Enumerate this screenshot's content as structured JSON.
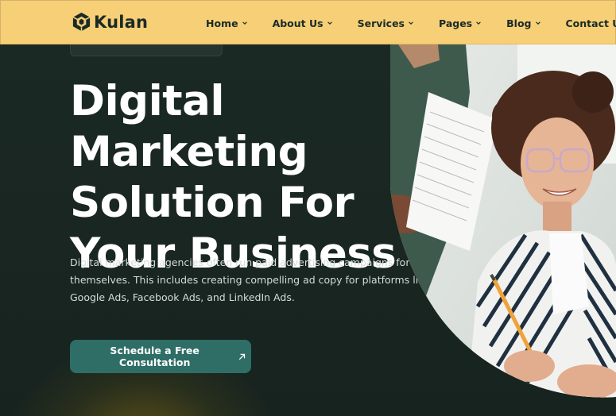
{
  "brand": {
    "name": "Kulan",
    "logo_icon": "cube-logo-icon"
  },
  "nav": {
    "items": [
      {
        "label": "Home",
        "has_dropdown": true
      },
      {
        "label": "About Us",
        "has_dropdown": true
      },
      {
        "label": "Services",
        "has_dropdown": true
      },
      {
        "label": "Pages",
        "has_dropdown": true
      },
      {
        "label": "Blog",
        "has_dropdown": true
      },
      {
        "label": "Contact Us",
        "has_dropdown": false
      }
    ]
  },
  "hero": {
    "title": "Digital Marketing Solution For Your Business",
    "description": "Digital marketing agencies often run paid advertising campaigns for themselves. This includes creating compelling ad copy for platforms like Google Ads, Facebook Ads, and LinkedIn Ads.",
    "cta_label": "Schedule a Free Consultation",
    "cta_icon": "arrow-up-right-icon",
    "image_alt": "smiling-woman-writing-icon"
  },
  "colors": {
    "header_bg": "#f6cf76",
    "hero_bg": "#1a2622",
    "accent": "#2e6e66",
    "text_dark": "#1b2a26",
    "text_light": "#ffffff"
  }
}
